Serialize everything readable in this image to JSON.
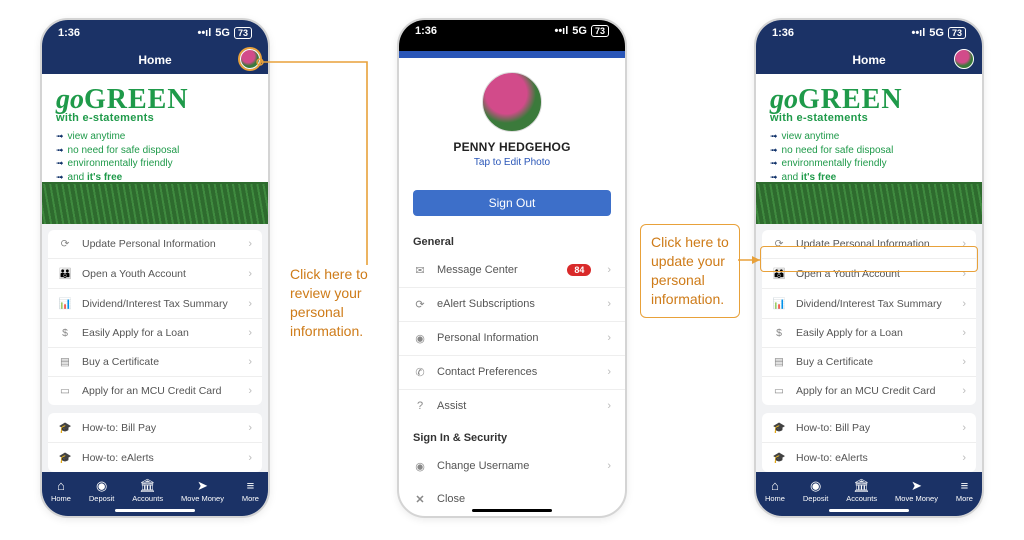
{
  "status": {
    "time": "1:36",
    "net": "5G",
    "battery": "73"
  },
  "home": {
    "title": "Home",
    "banner": {
      "go": "go",
      "green": "GREEN",
      "sub": "with e-statements",
      "points": [
        "view anytime",
        "no need for safe disposal",
        "environmentally friendly",
        "and "
      ],
      "free": "it's free"
    },
    "quick": [
      {
        "icon": "refresh-icon",
        "glyph": "⟳",
        "label": "Update Personal Information"
      },
      {
        "icon": "family-icon",
        "glyph": "👪",
        "label": "Open a Youth Account"
      },
      {
        "icon": "chart-icon",
        "glyph": "📊",
        "label": "Dividend/Interest Tax Summary"
      },
      {
        "icon": "money-icon",
        "glyph": "$",
        "label": "Easily Apply for a Loan"
      },
      {
        "icon": "doc-icon",
        "glyph": "▤",
        "label": "Buy a Certificate"
      },
      {
        "icon": "card-icon",
        "glyph": "▭",
        "label": "Apply for an MCU Credit Card"
      }
    ],
    "howto": [
      {
        "icon": "cap-icon",
        "glyph": "🎓",
        "label": "How-to: Bill Pay"
      },
      {
        "icon": "cap-icon",
        "glyph": "🎓",
        "label": "How-to: eAlerts"
      }
    ],
    "nav": [
      {
        "icon": "home-icon",
        "glyph": "⌂",
        "label": "Home"
      },
      {
        "icon": "camera-icon",
        "glyph": "◉",
        "label": "Deposit"
      },
      {
        "icon": "bank-icon",
        "glyph": "🏛",
        "label": "Accounts"
      },
      {
        "icon": "send-icon",
        "glyph": "➤",
        "label": "Move Money"
      },
      {
        "icon": "menu-icon",
        "glyph": "≡",
        "label": "More"
      }
    ]
  },
  "profile": {
    "name": "PENNY HEDGEHOG",
    "edit": "Tap to Edit Photo",
    "signout": "Sign Out",
    "general_label": "General",
    "general": [
      {
        "icon": "mail-icon",
        "glyph": "✉",
        "label": "Message Center",
        "badge": "84"
      },
      {
        "icon": "refresh-icon",
        "glyph": "⟳",
        "label": "eAlert Subscriptions"
      },
      {
        "icon": "person-icon",
        "glyph": "◉",
        "label": "Personal Information"
      },
      {
        "icon": "phone-icon",
        "glyph": "✆",
        "label": "Contact Preferences"
      },
      {
        "icon": "help-icon",
        "glyph": "?",
        "label": "Assist"
      }
    ],
    "security_label": "Sign In & Security",
    "security": [
      {
        "icon": "person-icon",
        "glyph": "◉",
        "label": "Change Username"
      }
    ],
    "close": "Close"
  },
  "annot": {
    "review": "Click here to review your personal information.",
    "update": "Click here to update your personal information."
  }
}
